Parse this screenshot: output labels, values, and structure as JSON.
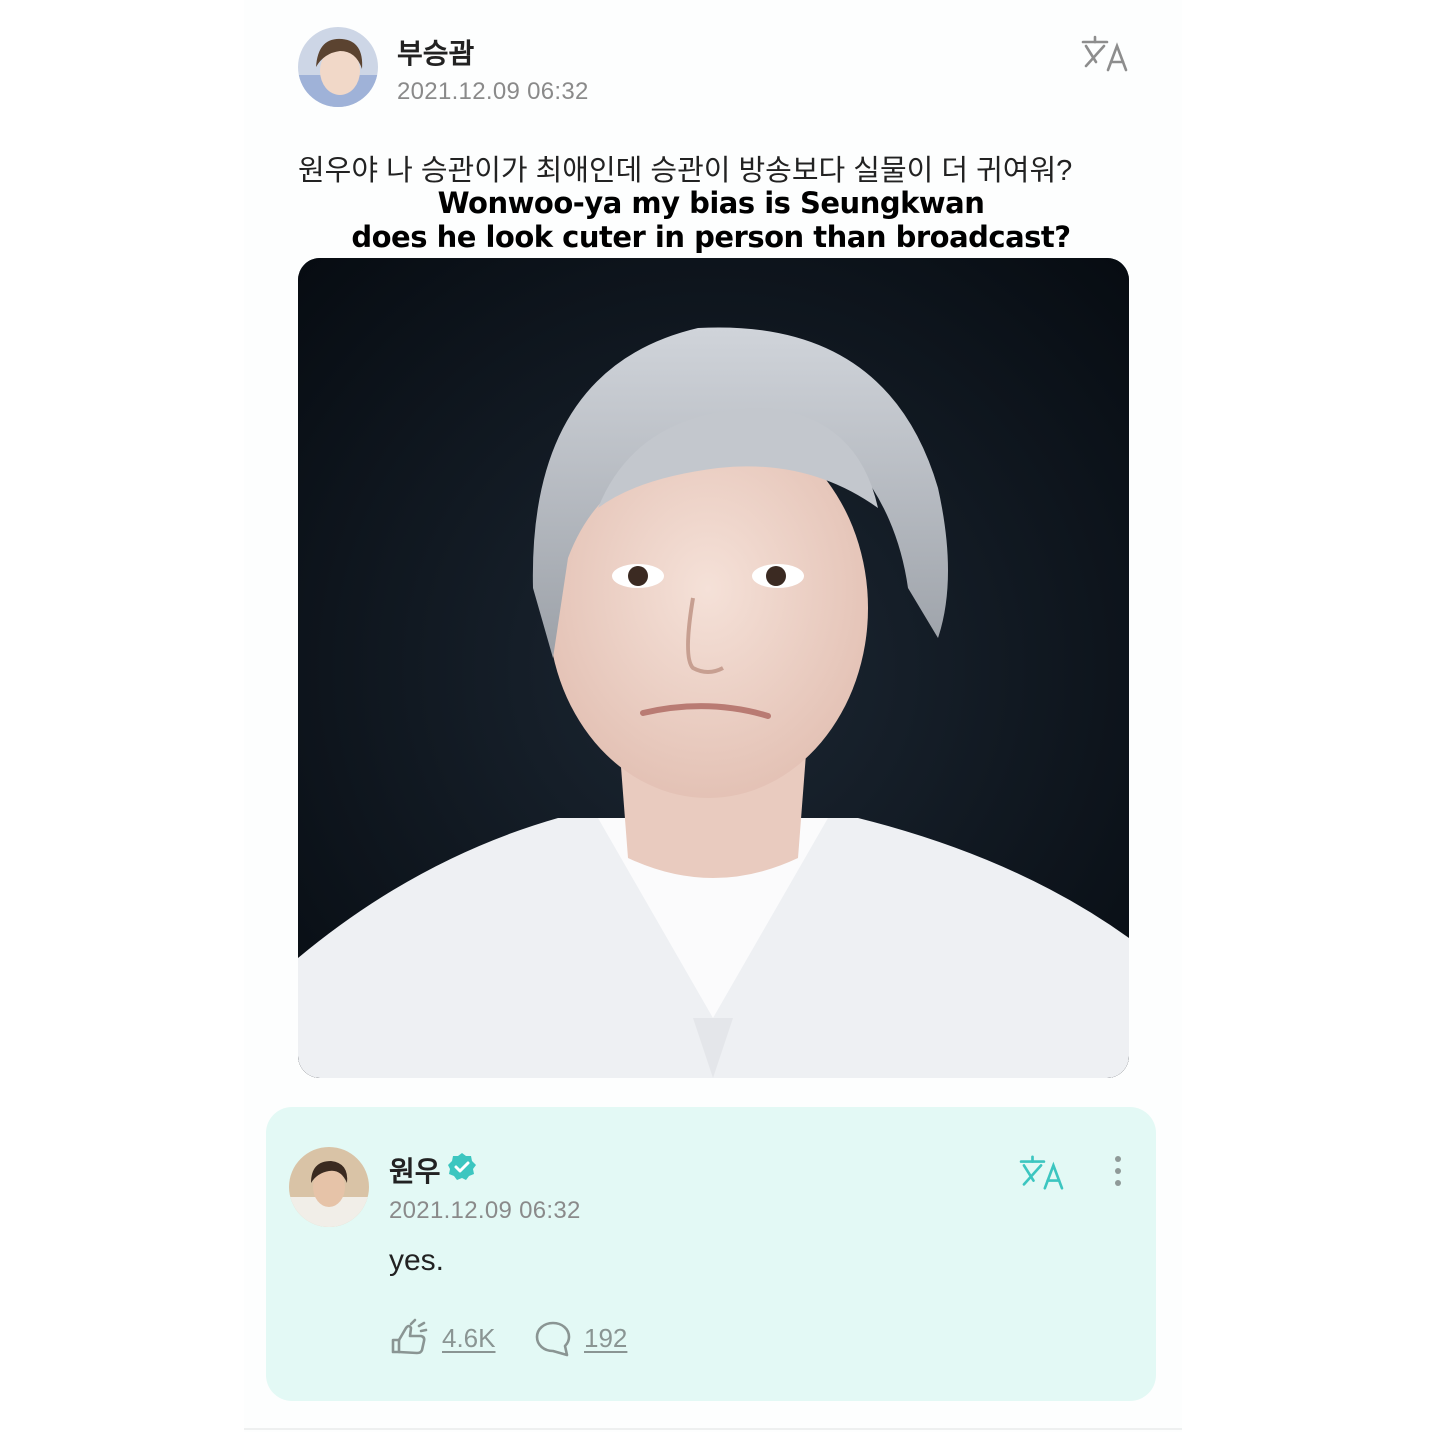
{
  "post": {
    "author_name": "부승괌",
    "timestamp": "2021.12.09 06:32",
    "body": "원우야 나 승관이가 최애인데 승관이 방송보다 실물이 더 귀여워?",
    "caption_line1": "Wonwoo-ya my bias is Seungkwan",
    "caption_line2": "does he look cuter in person than broadcast?",
    "translate_icon": "translate-icon",
    "image_icon": "photo-of-person"
  },
  "reply": {
    "author_name": "원우",
    "verified_icon": "verified-badge-icon",
    "timestamp": "2021.12.09 06:32",
    "text": "yes.",
    "likes": "4.6K",
    "comments": "192",
    "like_icon": "like-icon",
    "comment_icon": "comment-icon",
    "more_icon": "more-vertical-icon",
    "accent_color": "#3cc6c0"
  }
}
